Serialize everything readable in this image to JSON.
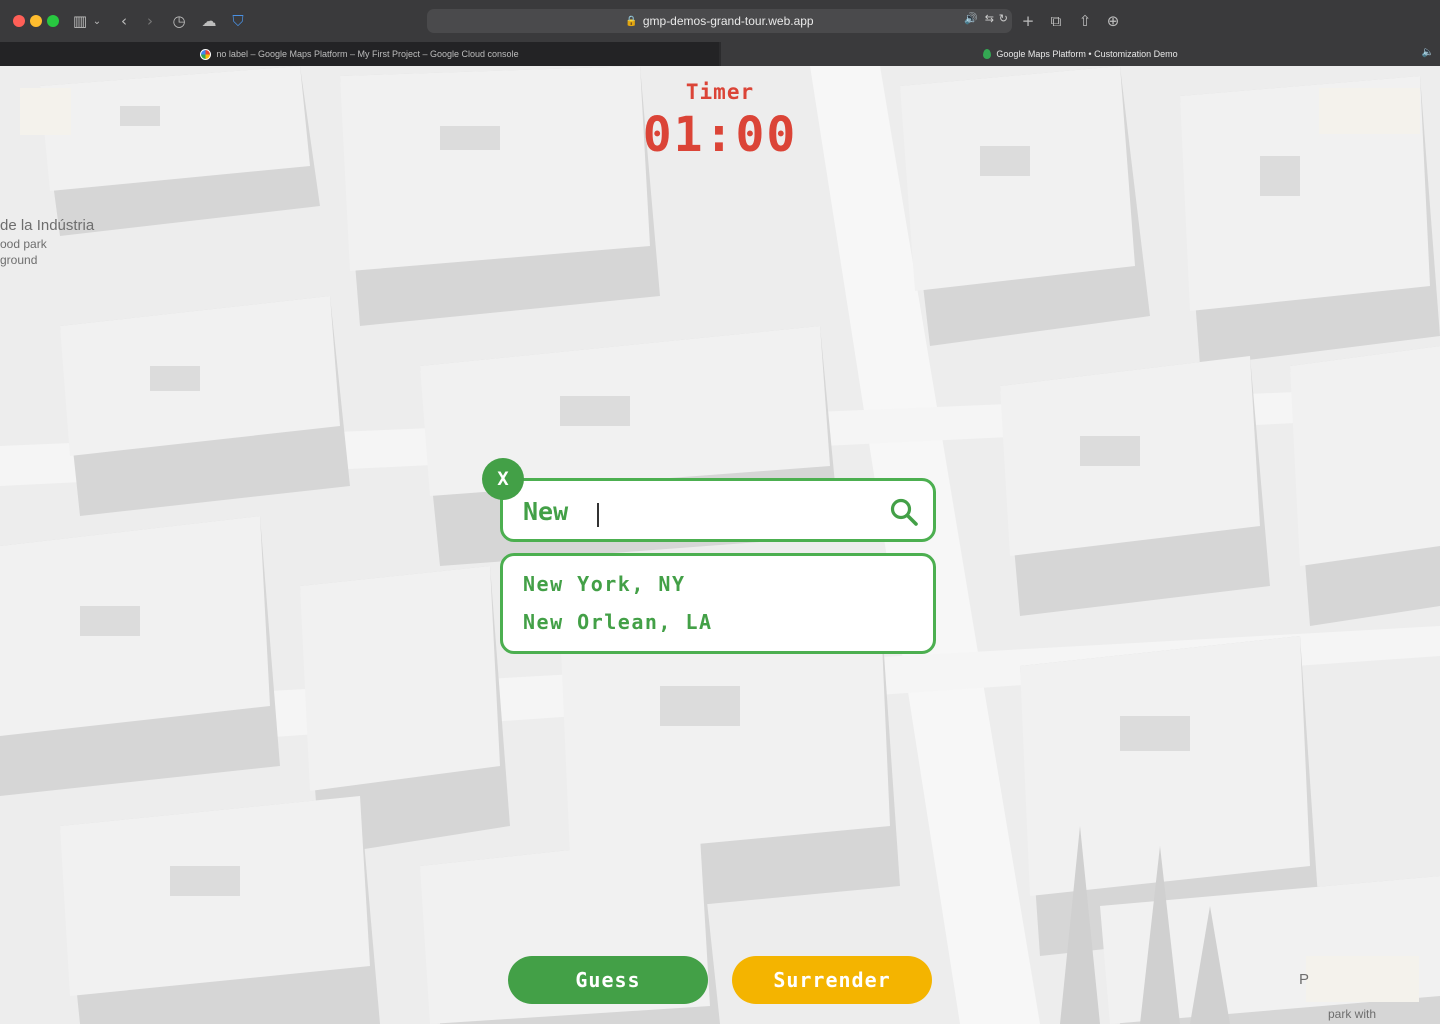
{
  "browser": {
    "url": "gmp-demos-grand-tour.web.app",
    "tabs": [
      {
        "label": "no label – Google Maps Platform – My First Project – Google Cloud console"
      },
      {
        "label": "Google Maps Platform • Customization Demo"
      }
    ]
  },
  "map": {
    "labels": [
      "de la Indústria",
      "ood park",
      "ground",
      "park with"
    ],
    "corner_letter": "P"
  },
  "game": {
    "timer_label": "Timer",
    "timer_value": "01:00",
    "search_value": "New",
    "close_symbol": "X",
    "suggestions": [
      "New York, NY",
      "New Orlean, LA"
    ],
    "guess_label": "Guess",
    "surrender_label": "Surrender"
  },
  "colors": {
    "accent_green": "#43a047",
    "timer_red": "#db4437",
    "surrender_yellow": "#f4b400"
  }
}
